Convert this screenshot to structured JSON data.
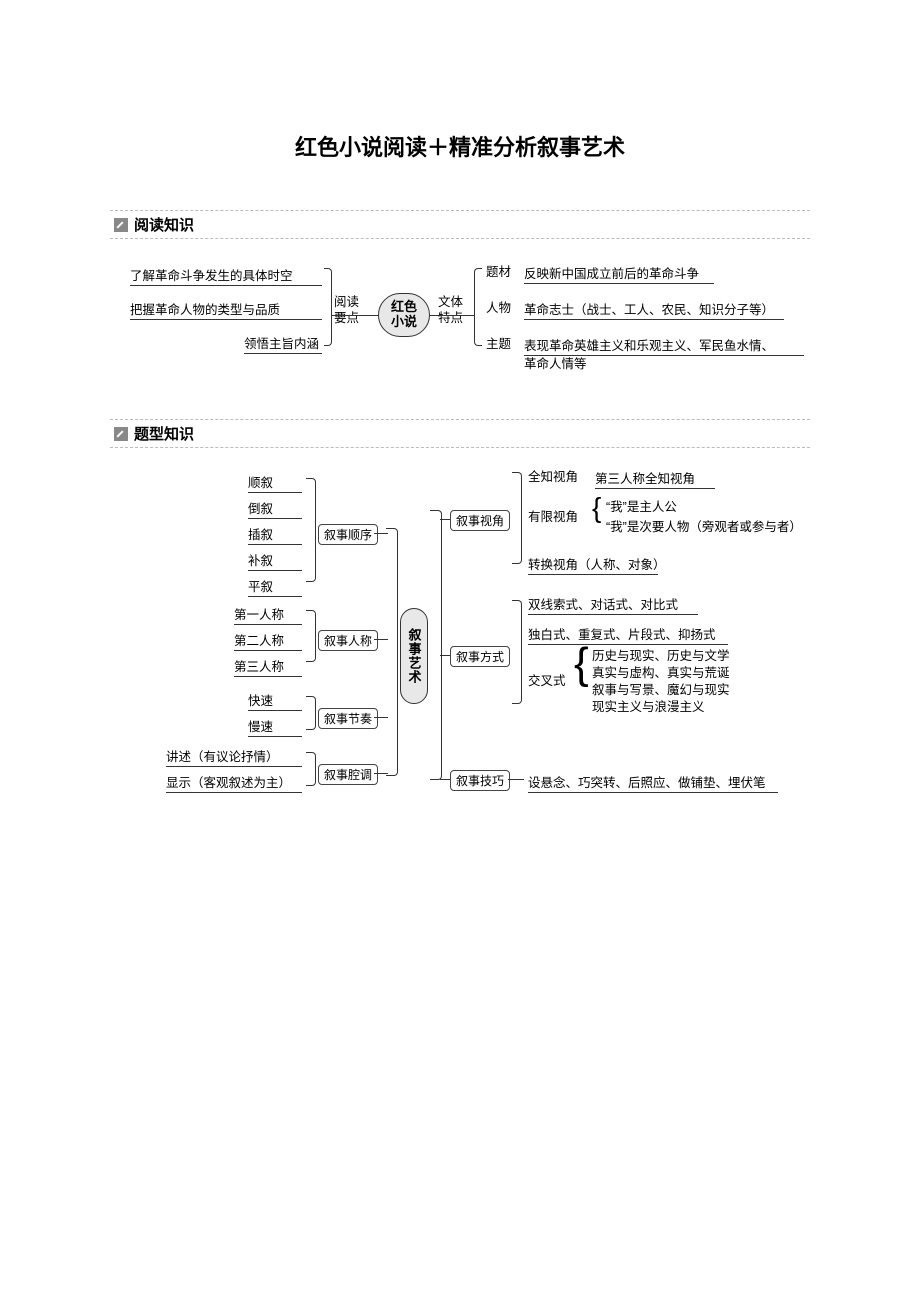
{
  "title": "红色小说阅读＋精准分析叙事艺术",
  "section1": "阅读知识",
  "section2": "题型知识",
  "d1": {
    "center": "红色\n小说",
    "leftLabel": "阅读\n要点",
    "rightLabel": "文体\n特点",
    "leftItems": [
      "了解革命斗争发生的具体时空",
      "把握革命人物的类型与品质",
      "领悟主旨内涵"
    ],
    "rightHeads": [
      "题材",
      "人物",
      "主题"
    ],
    "rightTexts": [
      "反映新中国成立前后的革命斗争",
      "革命志士（战士、工人、农民、知识分子等）",
      "表现革命英雄主义和乐观主义、军民鱼水情、",
      "革命人情等"
    ]
  },
  "d2": {
    "center": "叙事艺术",
    "left": {
      "g1": {
        "label": "叙事顺序",
        "items": [
          "顺叙",
          "倒叙",
          "插叙",
          "补叙",
          "平叙"
        ]
      },
      "g2": {
        "label": "叙事人称",
        "items": [
          "第一人称",
          "第二人称",
          "第三人称"
        ]
      },
      "g3": {
        "label": "叙事节奏",
        "items": [
          "快速",
          "慢速"
        ]
      },
      "g4": {
        "label": "叙事腔调",
        "items": [
          "讲述（有议论抒情）",
          "显示（客观叙述为主）"
        ]
      }
    },
    "right": {
      "r1": {
        "label": "叙事视角",
        "a": "全知视角",
        "a2": "第三人称全知视角",
        "b": "有限视角",
        "b1": "“我”是主人公",
        "b2": "“我”是次要人物（旁观者或参与者）",
        "c": "转换视角（人称、对象）"
      },
      "r2": {
        "label": "叙事方式",
        "a": "双线索式、对话式、对比式",
        "b": "独白式、重复式、片段式、抑扬式",
        "c": "交叉式",
        "c_detail": "历史与现实、历史与文学\n真实与虚构、真实与荒诞\n叙事与写景、魔幻与现实\n现实主义与浪漫主义"
      },
      "r3": {
        "label": "叙事技巧",
        "a": "设悬念、巧突转、后照应、做铺垫、埋伏笔"
      }
    }
  }
}
